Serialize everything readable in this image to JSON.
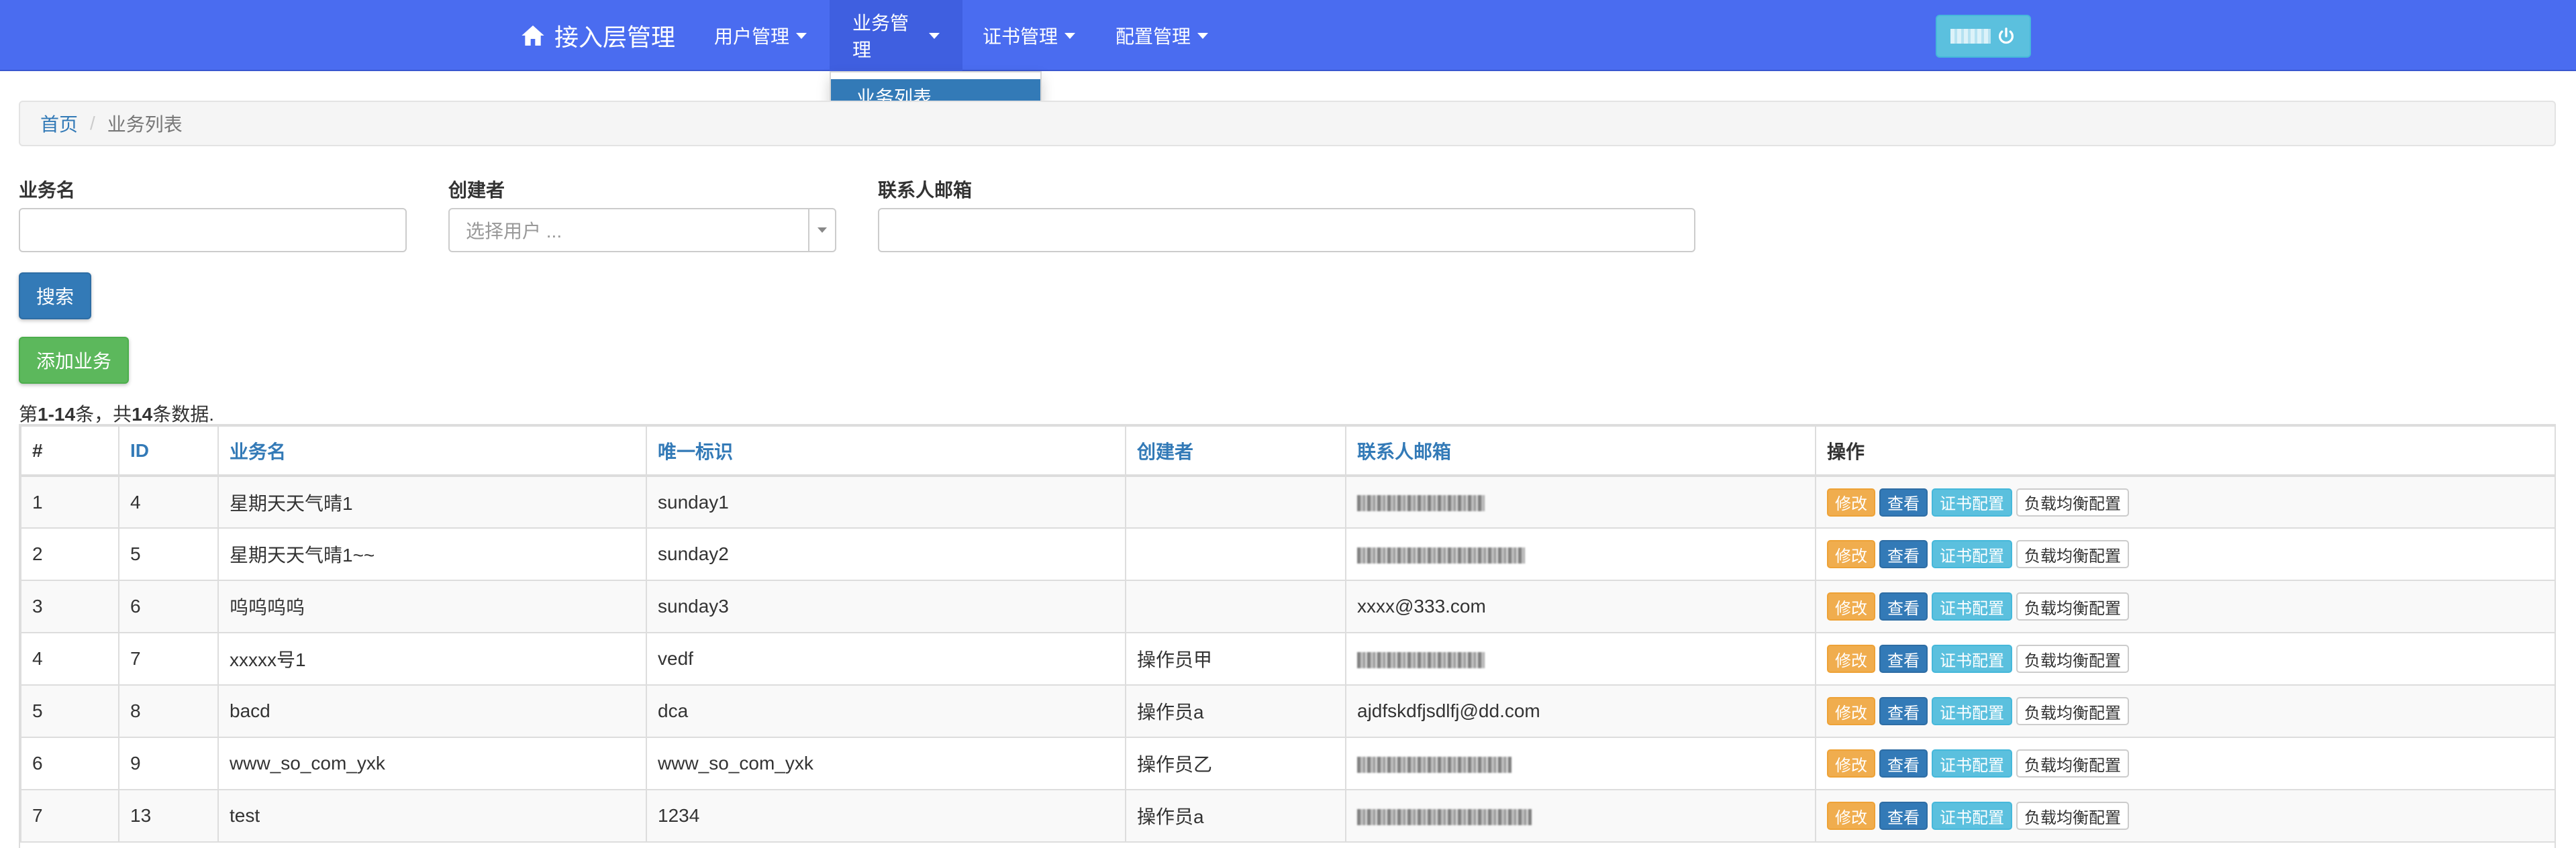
{
  "navbar": {
    "brand": "接入层管理",
    "menus": [
      {
        "label": "用户管理"
      },
      {
        "label": "业务管理"
      },
      {
        "label": "证书管理"
      },
      {
        "label": "配置管理"
      }
    ],
    "dropdown_item": "业务列表",
    "brand_color": "#4a6cf0"
  },
  "breadcrumb": {
    "home": "首页",
    "current": "业务列表"
  },
  "search": {
    "business_name_label": "业务名",
    "business_name_value": "",
    "creator_label": "创建者",
    "creator_placeholder": "选择用户 ...",
    "email_label": "联系人邮箱",
    "email_value": "",
    "search_button": "搜索",
    "add_button": "添加业务"
  },
  "summary": {
    "prefix": "第",
    "range": "1-14",
    "middle": "条，共",
    "total": "14",
    "suffix": "条数据."
  },
  "table": {
    "headers": [
      "#",
      "ID",
      "业务名",
      "唯一标识",
      "创建者",
      "联系人邮箱",
      "操作"
    ],
    "rows": [
      {
        "num": "1",
        "id": "4",
        "name": "星期天天气晴1",
        "key": "sunday1",
        "creator": "",
        "email": "",
        "email_blurred": true
      },
      {
        "num": "2",
        "id": "5",
        "name": "星期天天气晴1~~",
        "key": "sunday2",
        "creator": "",
        "email": "",
        "email_blurred": true
      },
      {
        "num": "3",
        "id": "6",
        "name": "呜呜呜呜",
        "key": "sunday3",
        "creator": "",
        "email": "xxxx@333.com",
        "email_blurred": false
      },
      {
        "num": "4",
        "id": "7",
        "name": "xxxxx号1",
        "key": "vedf",
        "creator": "操作员甲",
        "email": "",
        "email_blurred": true
      },
      {
        "num": "5",
        "id": "8",
        "name": "bacd",
        "key": "dca",
        "creator": "操作员a",
        "email": "ajdfskdfjsdlfj@dd.com",
        "email_blurred": false
      },
      {
        "num": "6",
        "id": "9",
        "name": "www_so_com_yxk",
        "key": "www_so_com_yxk",
        "creator": "操作员乙",
        "email": "",
        "email_blurred": true
      },
      {
        "num": "7",
        "id": "13",
        "name": "test",
        "key": "1234",
        "creator": "操作员a",
        "email": "",
        "email_blurred": true
      }
    ],
    "actions": {
      "edit": "修改",
      "view": "查看",
      "cert": "证书配置",
      "lb": "负载均衡配置"
    }
  }
}
